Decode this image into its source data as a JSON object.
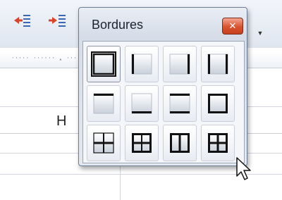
{
  "popup": {
    "title": "Bordures",
    "close_icon": "close-icon",
    "border_options": [
      {
        "icon": "border-outline-thick-icon",
        "selected": true
      },
      {
        "icon": "border-left-icon"
      },
      {
        "icon": "border-right-icon"
      },
      {
        "icon": "border-left-right-icon"
      },
      {
        "icon": "border-top-icon"
      },
      {
        "icon": "border-bottom-icon"
      },
      {
        "icon": "border-top-bottom-icon"
      },
      {
        "icon": "border-outline-icon"
      },
      {
        "icon": "border-inner-horizontal-icon"
      },
      {
        "icon": "border-all-icon"
      },
      {
        "icon": "border-inner-vertical-icon"
      },
      {
        "icon": "border-all-grid-icon"
      }
    ]
  },
  "toolbar": {
    "buttons": [
      "decrease-indent-icon",
      "increase-indent-icon"
    ],
    "dropdown_icon": "dropdown-arrow-icon"
  },
  "sheet": {
    "column_header": "H"
  },
  "colors": {
    "close_button": "#d9532f",
    "indent_arrow": "#d8452a",
    "indent_lines": "#3a66b8"
  }
}
